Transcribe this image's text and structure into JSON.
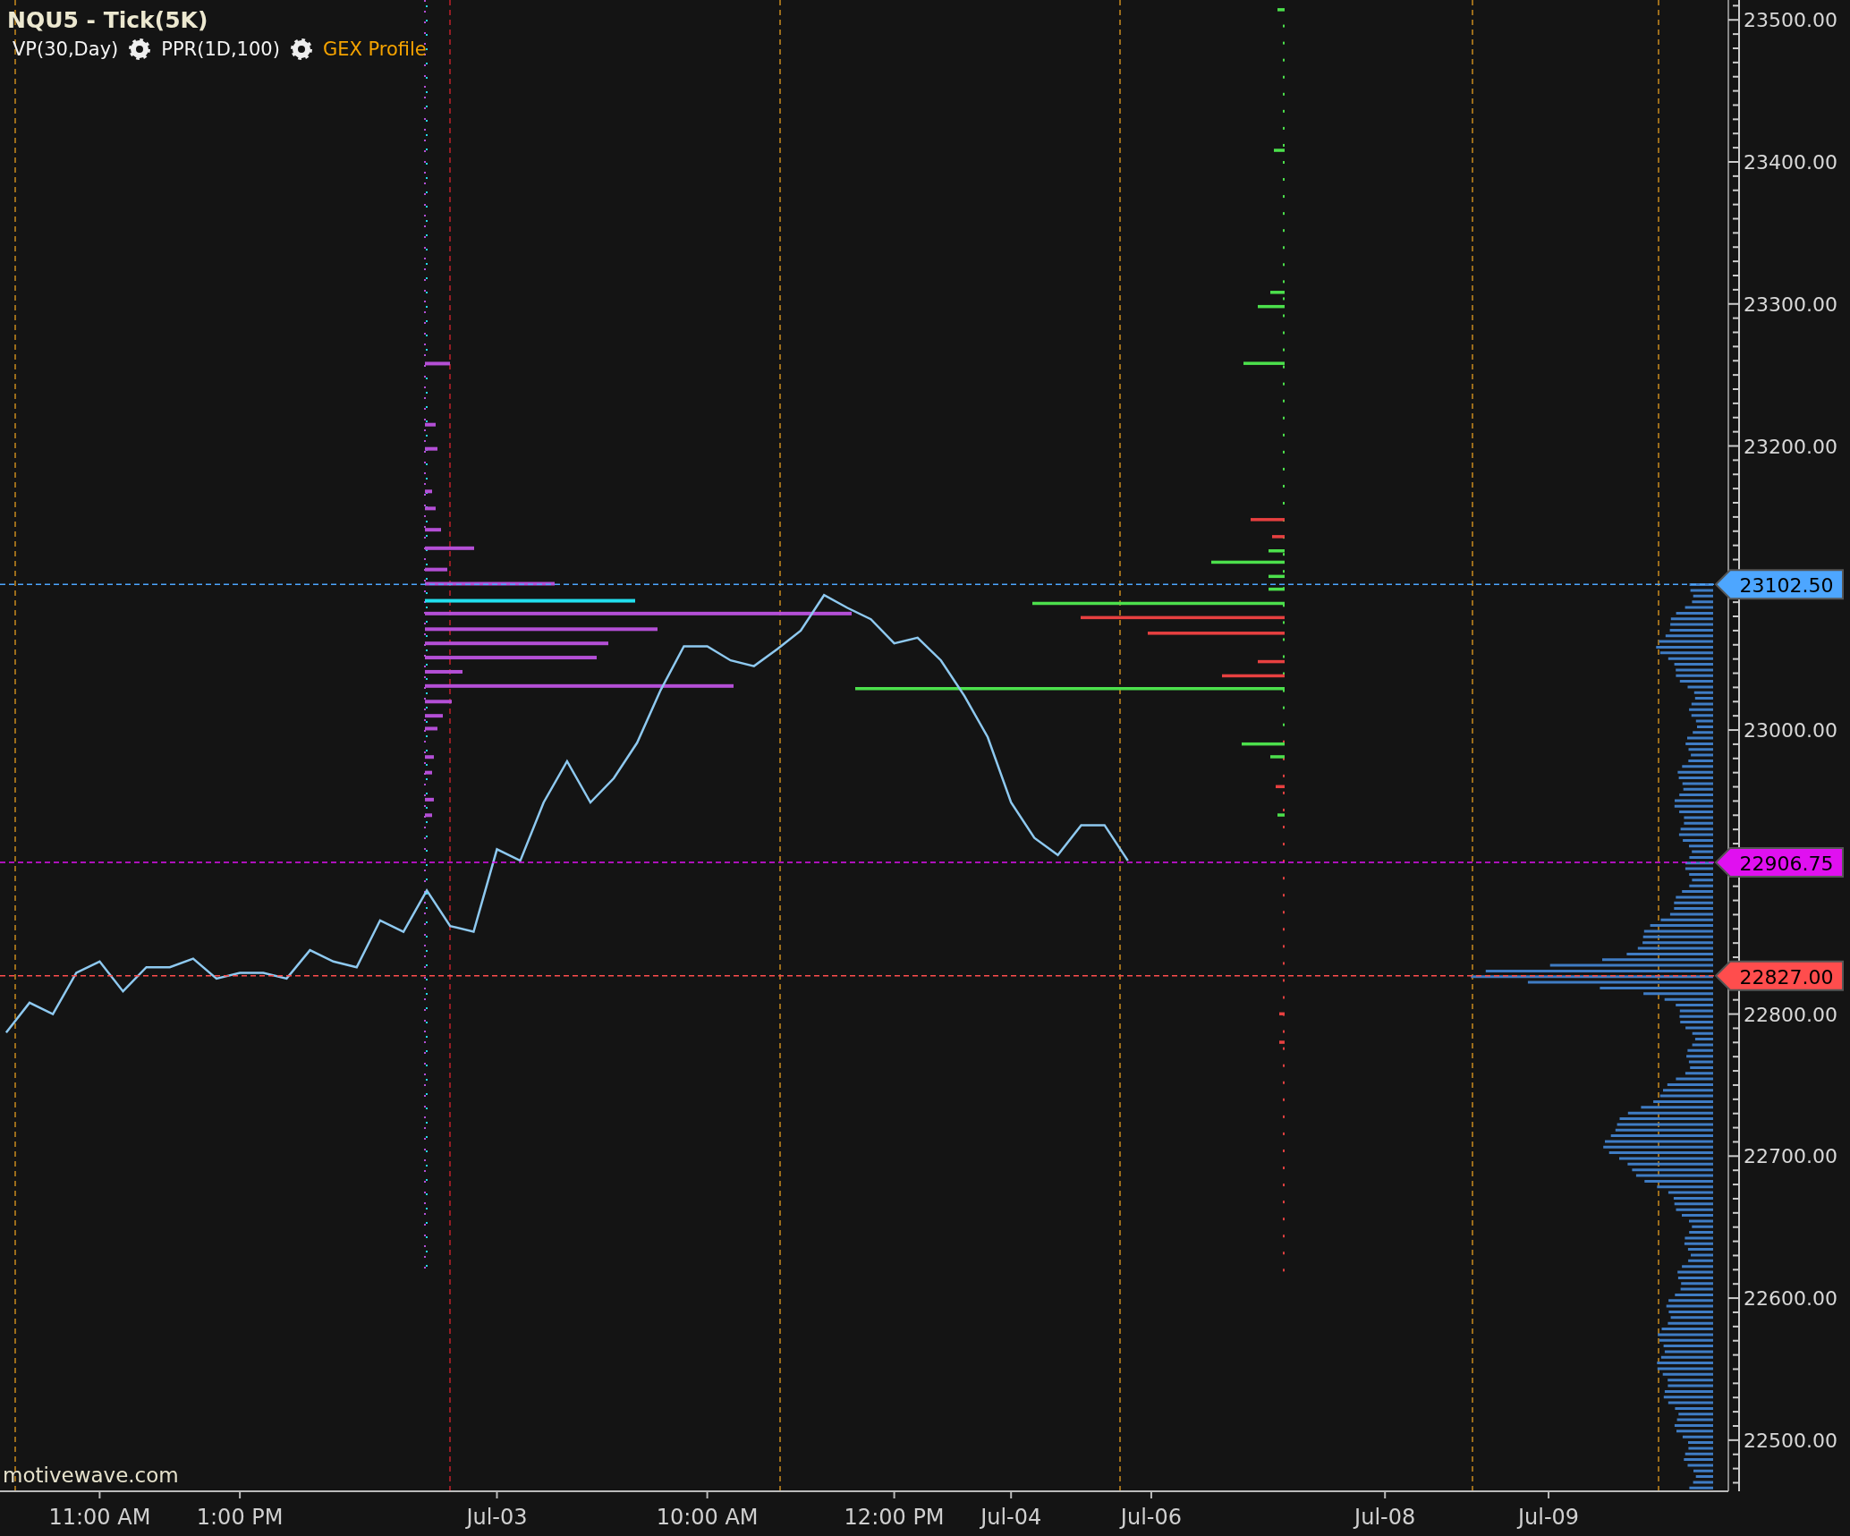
{
  "header": {
    "title": "NQU5 - Tick(5K)",
    "indicators": [
      {
        "label": "VP(30,Day)",
        "settings_icon": false,
        "highlighted": false
      },
      {
        "label": "PPR(1D,100)",
        "settings_icon": true,
        "highlighted": false
      },
      {
        "label": "GEX Profile",
        "settings_icon": true,
        "highlighted": true
      }
    ]
  },
  "watermark": "motivewave.com",
  "chart": {
    "chart_data": {
      "type": "line",
      "ylim": [
        22464,
        23514
      ],
      "yticks": [
        {
          "value": 23500,
          "label": "23500.00"
        },
        {
          "value": 23400,
          "label": "23400.00"
        },
        {
          "value": 23300,
          "label": "23300.00"
        },
        {
          "value": 23200,
          "label": "23200.00"
        },
        {
          "value": 23000,
          "label": "23000.00"
        },
        {
          "value": 22800,
          "label": "22800.00"
        },
        {
          "value": 22700,
          "label": "22700.00"
        },
        {
          "value": 22600,
          "label": "22600.00"
        },
        {
          "value": 22500,
          "label": "22500.00"
        }
      ],
      "categories": [
        null,
        null,
        null,
        null,
        "11:00 AM",
        null,
        null,
        null,
        null,
        null,
        "1:00 PM",
        null,
        null,
        null,
        null,
        null,
        null,
        null,
        null,
        null,
        null,
        "Jul-03",
        null,
        null,
        null,
        null,
        null,
        null,
        null,
        null,
        "10:00 AM",
        null,
        null,
        null,
        null,
        null,
        null,
        null,
        "12:00 PM",
        null,
        null,
        null,
        null,
        "Jul-04",
        null,
        null,
        null,
        null,
        null,
        "Jul-06",
        null,
        null,
        null,
        null,
        null,
        null,
        null,
        null,
        null,
        "Jul-08",
        null,
        null,
        null,
        null,
        null,
        null,
        "Jul-09",
        null,
        null,
        null,
        null,
        null,
        null
      ],
      "series": [
        {
          "color": "#8ec9f0",
          "values": [
            22787,
            22808,
            22800,
            22829,
            22837,
            22816,
            22833,
            22833,
            22839,
            22825,
            22829,
            22829,
            22825,
            22845,
            22837,
            22833,
            22866,
            22858,
            22887,
            22862,
            22858,
            22916,
            22908,
            22949,
            22978,
            22949,
            22966,
            22991,
            23028,
            23059,
            23059,
            23049,
            23045,
            23057,
            23070,
            23095,
            23086,
            23078,
            23061,
            23065,
            23049,
            23024,
            22995,
            22949,
            22924,
            22912,
            22933,
            22933,
            22908,
            null,
            null,
            null,
            null,
            null,
            null,
            null,
            null,
            null,
            null,
            null,
            null,
            null,
            null,
            null,
            null,
            null,
            null,
            null,
            null,
            null,
            null,
            null,
            null
          ]
        }
      ],
      "ref_lines": [
        {
          "axis": "y",
          "value": 23102.5,
          "label": "23102.50",
          "color": "#4da6ff"
        },
        {
          "axis": "y",
          "value": 22906.75,
          "label": "22906.75",
          "color": "#e010f0"
        },
        {
          "axis": "y",
          "value": 22827,
          "label": "22827.00",
          "color": "#ff4d4d"
        }
      ]
    }
  }
}
